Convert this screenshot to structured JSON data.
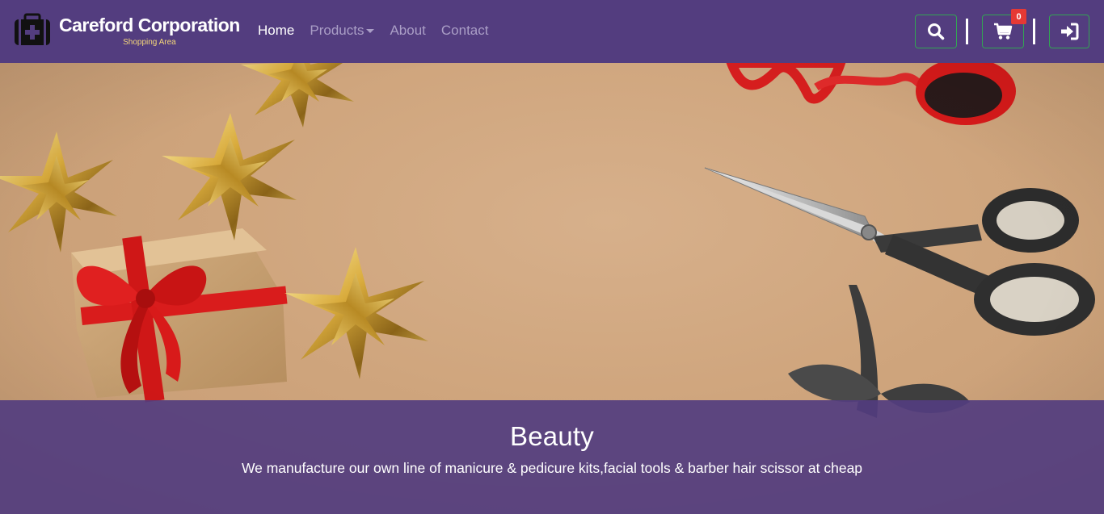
{
  "brand": {
    "title": "Careford Corporation",
    "subtitle": "Shopping Area",
    "icon": "medical-kit-icon"
  },
  "nav": {
    "links": [
      {
        "label": "Home",
        "active": true
      },
      {
        "label": "Products",
        "dropdown": true
      },
      {
        "label": "About"
      },
      {
        "label": "Contact"
      }
    ]
  },
  "actions": {
    "search_icon": "search-icon",
    "cart_icon": "shopping-cart-icon",
    "cart_count": "0",
    "login_icon": "sign-in-icon"
  },
  "hero": {
    "title": "Beauty",
    "description": "We manufacture our own line of manicure & pedicure kits,facial tools & barber hair scissor at cheap"
  },
  "colors": {
    "navbar": "#533d7f",
    "button_border": "#33a454",
    "badge": "#e53935",
    "brand_subtitle": "#f5d77a"
  }
}
